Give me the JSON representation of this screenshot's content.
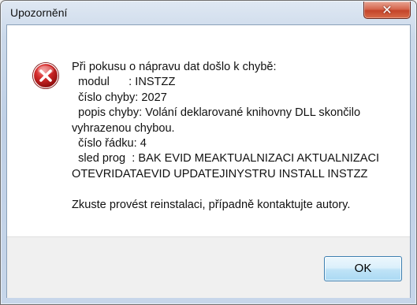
{
  "window": {
    "title": "Upozornění",
    "close_glyph": "✕"
  },
  "icon": {
    "name": "error-icon",
    "color": "#c8202a"
  },
  "message": {
    "lines": [
      "Při pokusu o nápravu dat došlo k chybě:",
      "  modul      : INSTZZ",
      "  číslo chyby: 2027",
      "  popis chyby: Volání deklarované knihovny DLL skončilo",
      "vyhrazenou chybou.",
      "  číslo řádku: 4",
      "  sled prog  : BAK EVID MEAKTUALNIZACI AKTUALNIZACI",
      "OTEVRIDATAEVID UPDATEJINYSTRU INSTALL INSTZZ",
      "",
      "Zkuste provést reinstalaci, případně kontaktujte autory."
    ]
  },
  "buttons": {
    "ok_label": "OK"
  }
}
